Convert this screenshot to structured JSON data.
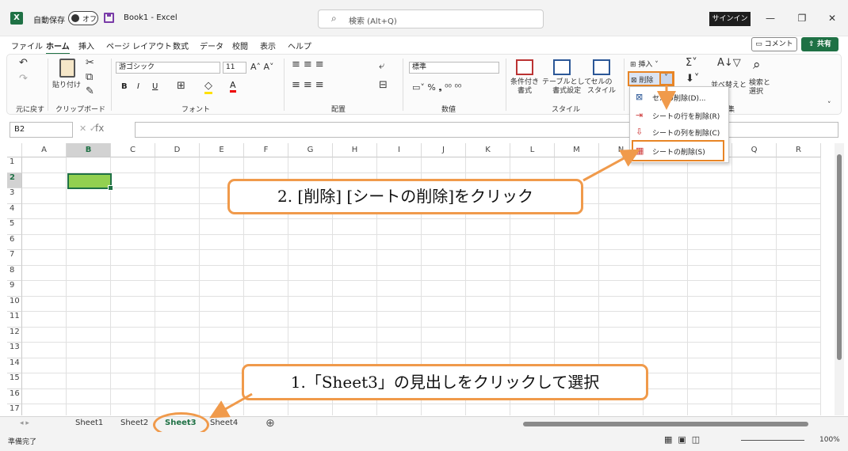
{
  "titlebar": {
    "app_icon": "X",
    "autosave_label": "自動保存",
    "autosave_state": "オフ",
    "doc_title": "Book1 - Excel",
    "search_placeholder": "検索 (Alt+Q)",
    "signin_label": "サインイン",
    "minimize": "—",
    "restore": "❐",
    "close": "✕"
  },
  "menu": {
    "tabs": [
      "ファイル",
      "ホーム",
      "挿入",
      "ページ レイアウト",
      "数式",
      "データ",
      "校閲",
      "表示",
      "ヘルプ"
    ],
    "comment_label": "コメント",
    "share_label": "共有"
  },
  "ribbon": {
    "groups": [
      "元に戻す",
      "クリップボード",
      "フォント",
      "配置",
      "数値",
      "スタイル"
    ],
    "paste_label": "貼り付け",
    "font_name": "游ゴシック",
    "font_size": "11",
    "number_format": "標準",
    "cond_format_label": "条件付き\n書式",
    "table_format_label": "テーブルとして\n書式設定",
    "cell_style_label": "セルの\nスタイル",
    "insert_label": "挿入",
    "delete_label": "削除",
    "sort_label": "並べ替えと",
    "find_label": "検索と\n選択",
    "edit_group_partial": "集"
  },
  "formula": {
    "name_box": "B2",
    "fx": "fx"
  },
  "grid": {
    "columns": [
      "A",
      "B",
      "C",
      "D",
      "E",
      "F",
      "G",
      "H",
      "I",
      "J",
      "K",
      "L",
      "M",
      "N",
      "O",
      "P",
      "Q",
      "R"
    ],
    "rows": [
      "1",
      "2",
      "3",
      "4",
      "5",
      "6",
      "7",
      "8",
      "9",
      "10",
      "11",
      "12",
      "13",
      "14",
      "15",
      "16",
      "17"
    ],
    "fill_color": "#92d050"
  },
  "sheets": {
    "tabs": [
      "Sheet1",
      "Sheet2",
      "Sheet3",
      "Sheet4"
    ],
    "active": "Sheet3",
    "add_icon": "⊕"
  },
  "status": {
    "ready": "準備完了",
    "zoom": "100%"
  },
  "dropdown": {
    "items": [
      "セルの削除(D)...",
      "シートの行を削除(R)",
      "シートの列を削除(C)",
      "シートの削除(S)"
    ]
  },
  "callouts": {
    "step2": "2. [削除] [シートの削除]をクリック",
    "step1": "1.「Sheet3」の見出しをクリックして選択"
  },
  "colors": {
    "excel_green": "#1f7145",
    "callout_orange": "#f09a4b"
  }
}
